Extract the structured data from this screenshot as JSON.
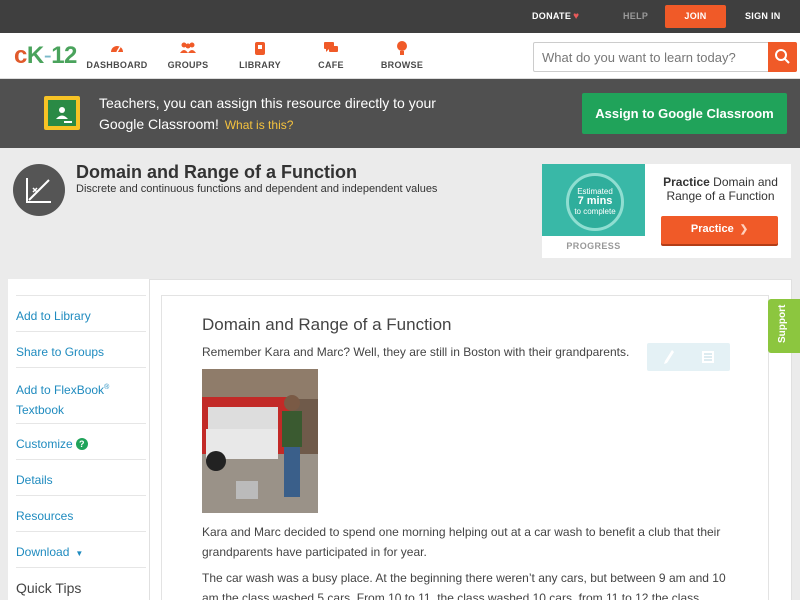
{
  "topbar": {
    "donate": "DONATE",
    "help": "HELP",
    "join": "JOIN",
    "sign_in": "SIGN IN"
  },
  "navbar": {
    "logo": {
      "c": "c",
      "k": "K",
      "dash": "-",
      "num": "12"
    },
    "items": [
      {
        "label": "DASHBOARD",
        "icon": "dashboard-icon"
      },
      {
        "label": "GROUPS",
        "icon": "groups-icon"
      },
      {
        "label": "LIBRARY",
        "icon": "library-icon"
      },
      {
        "label": "CAFE",
        "icon": "cafe-icon"
      },
      {
        "label": "BROWSE",
        "icon": "browse-icon"
      }
    ],
    "search_placeholder": "What do you want to learn today?"
  },
  "banner": {
    "text": "Teachers, you can assign this resource directly to your Google Classroom!",
    "what_link": "What is this?",
    "assign_button": "Assign to Google Classroom"
  },
  "header": {
    "title": "Domain and Range of a Function",
    "subtitle": "Discrete and continuous functions and dependent and independent values"
  },
  "practice": {
    "estimated": "Estimated",
    "mins": "7 mins",
    "to_complete": "to complete",
    "progress_label": "PROGRESS",
    "title_bold": "Practice",
    "title_rest": " Domain and Range of a Function",
    "button": "Practice"
  },
  "sidebar": {
    "add_library": "Add to Library",
    "share_groups": "Share to Groups",
    "add_flexbook_1": "Add to FlexBook",
    "add_flexbook_reg": "®",
    "add_flexbook_2": "Textbook",
    "customize": "Customize",
    "details": "Details",
    "resources": "Resources",
    "download": "Download",
    "quick_tips": "Quick Tips"
  },
  "content": {
    "title": "Domain and Range of a Function",
    "p1": "Remember Kara and Marc? Well, they are still in Boston with their grandparents.",
    "p2": "Kara and Marc decided to spend one morning helping out at a car wash to benefit a club that their grandparents have participated in for year.",
    "p3": "The car wash was a busy place. At the beginning there weren’t any cars, but between 9 am and 10 am the class washed 5 cars. From 10 to 11, the class washed 10 cars, from 11 to 12 the class"
  },
  "support_tab": "Support",
  "colors": {
    "accent_orange": "#f05a28",
    "green": "#20a35a",
    "link_blue": "#1f8bbf",
    "teal": "#39b8a7",
    "support_green": "#8cc63f"
  }
}
